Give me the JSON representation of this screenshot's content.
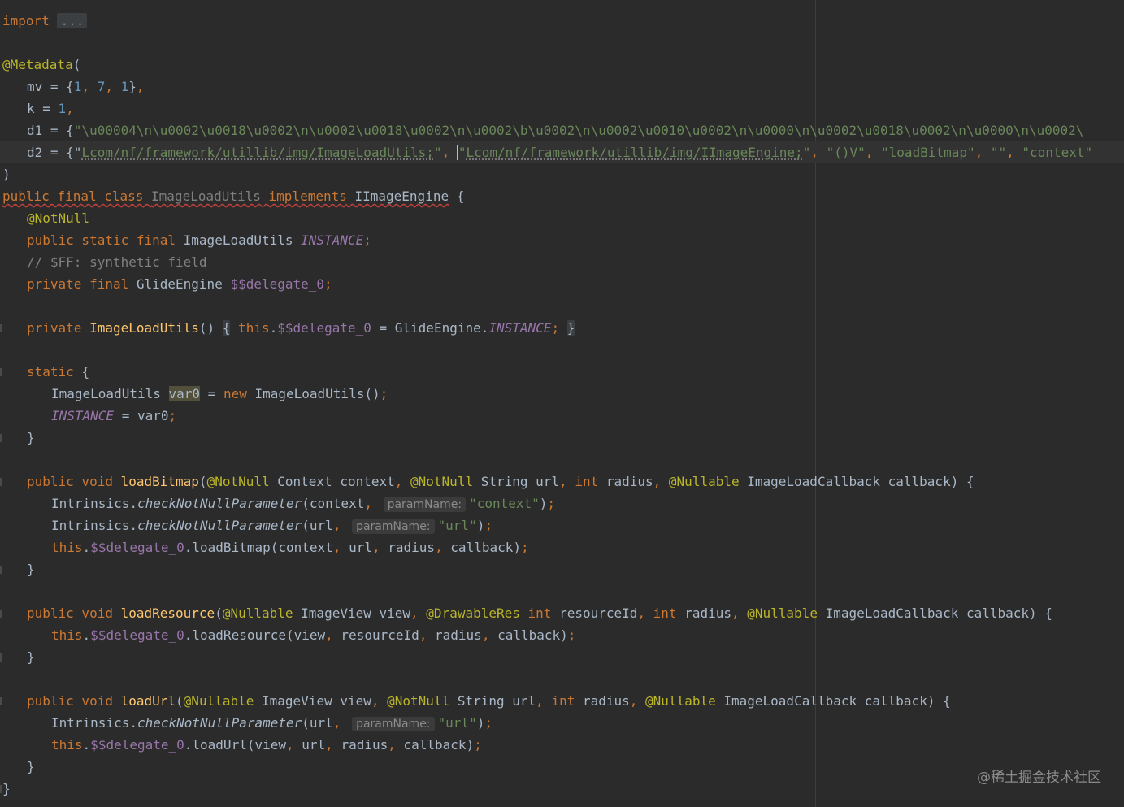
{
  "editor": {
    "current_line_index": 6,
    "lines": [
      {
        "indent": 0,
        "tokens": [
          {
            "t": "import",
            "c": "kw"
          },
          {
            "t": " "
          },
          {
            "t": "...",
            "c": "fold"
          }
        ]
      },
      {
        "indent": 0,
        "tokens": []
      },
      {
        "indent": 0,
        "tokens": [
          {
            "t": "@Metadata",
            "c": "ann"
          },
          {
            "t": "("
          }
        ]
      },
      {
        "indent": 1,
        "tokens": [
          {
            "t": "mv = {"
          },
          {
            "t": "1",
            "c": "num"
          },
          {
            "t": ", ",
            "c": "kw"
          },
          {
            "t": "7",
            "c": "num"
          },
          {
            "t": ", ",
            "c": "kw"
          },
          {
            "t": "1",
            "c": "num"
          },
          {
            "t": "}"
          },
          {
            "t": ",",
            "c": "kw"
          }
        ]
      },
      {
        "indent": 1,
        "tokens": [
          {
            "t": "k = "
          },
          {
            "t": "1",
            "c": "num"
          },
          {
            "t": ",",
            "c": "kw"
          }
        ]
      },
      {
        "indent": 1,
        "tokens": [
          {
            "t": "d1 = {"
          },
          {
            "t": "\"\\u00004\\n\\u0002\\u0018\\u0002\\n\\u0002\\u0018\\u0002\\n\\u0002\\b\\u0002\\n\\u0002\\u0010\\u0002\\n\\u0000\\n\\u0002\\u0018\\u0002\\n\\u0000\\n\\u0002\\",
            "c": "str"
          }
        ]
      },
      {
        "indent": 1,
        "tokens": [
          {
            "t": "d2 = {"
          },
          {
            "t": "\""
          },
          {
            "t": "Lcom/nf/framework/utillib/img/ImageLoadUtils;",
            "c": "str",
            "typo": true
          },
          {
            "t": "\"",
            "c": "str"
          },
          {
            "t": ", ",
            "c": "kw"
          },
          {
            "t": "",
            "caret": true
          },
          {
            "t": "\"",
            "c": "str"
          },
          {
            "t": "Lcom/nf/framework/utillib/img/IImageEngine;",
            "c": "str",
            "typo": true
          },
          {
            "t": "\"",
            "c": "str"
          },
          {
            "t": ", ",
            "c": "kw"
          },
          {
            "t": "\"()V\"",
            "c": "str"
          },
          {
            "t": ", ",
            "c": "kw"
          },
          {
            "t": "\"loadBitmap\"",
            "c": "str"
          },
          {
            "t": ", ",
            "c": "kw"
          },
          {
            "t": "\"\"",
            "c": "str"
          },
          {
            "t": ", ",
            "c": "kw"
          },
          {
            "t": "\"context\"",
            "c": "str"
          }
        ]
      },
      {
        "indent": 0,
        "tokens": [
          {
            "t": ")"
          }
        ]
      },
      {
        "indent": 0,
        "tokens": [
          {
            "t": "public final class ",
            "c": "kw",
            "warn": true
          },
          {
            "t": "ImageLoadUtils",
            "c": "unused",
            "warn": true
          },
          {
            "t": " ",
            "warn": true
          },
          {
            "t": "implements",
            "c": "kw",
            "warn": true
          },
          {
            "t": " IImageEngine",
            "warn": true
          },
          {
            "t": " {"
          }
        ]
      },
      {
        "indent": 1,
        "tokens": [
          {
            "t": "@NotNull",
            "c": "ann"
          }
        ]
      },
      {
        "indent": 1,
        "tokens": [
          {
            "t": "public static final ",
            "c": "kw"
          },
          {
            "t": "ImageLoadUtils "
          },
          {
            "t": "INSTANCE",
            "c": "static"
          },
          {
            "t": ";",
            "c": "kw"
          }
        ]
      },
      {
        "indent": 1,
        "tokens": [
          {
            "t": "// $FF: synthetic field",
            "c": "cmt"
          }
        ]
      },
      {
        "indent": 1,
        "tokens": [
          {
            "t": "private final ",
            "c": "kw"
          },
          {
            "t": "GlideEngine "
          },
          {
            "t": "$$delegate_0",
            "c": "field"
          },
          {
            "t": ";",
            "c": "kw"
          }
        ]
      },
      {
        "indent": 0,
        "tokens": []
      },
      {
        "indent": 1,
        "tokens": [
          {
            "t": "private ",
            "c": "kw"
          },
          {
            "t": "ImageLoadUtils",
            "c": "method"
          },
          {
            "t": "() "
          },
          {
            "t": "{",
            "c": "foldbrace"
          },
          {
            "t": " "
          },
          {
            "t": "this",
            "c": "kw"
          },
          {
            "t": "."
          },
          {
            "t": "$$delegate_0",
            "c": "field"
          },
          {
            "t": " = GlideEngine."
          },
          {
            "t": "INSTANCE",
            "c": "static"
          },
          {
            "t": ";",
            "c": "kw"
          },
          {
            "t": " "
          },
          {
            "t": "}",
            "c": "foldbrace"
          }
        ]
      },
      {
        "indent": 0,
        "tokens": []
      },
      {
        "indent": 1,
        "tokens": [
          {
            "t": "static ",
            "c": "kw"
          },
          {
            "t": "{"
          }
        ]
      },
      {
        "indent": 2,
        "tokens": [
          {
            "t": "ImageLoadUtils "
          },
          {
            "t": "var0",
            "hl": true
          },
          {
            "t": " = "
          },
          {
            "t": "new ",
            "c": "kw"
          },
          {
            "t": "ImageLoadUtils()"
          },
          {
            "t": ";",
            "c": "kw"
          }
        ]
      },
      {
        "indent": 2,
        "tokens": [
          {
            "t": "INSTANCE",
            "c": "static"
          },
          {
            "t": " = var0"
          },
          {
            "t": ";",
            "c": "kw"
          }
        ]
      },
      {
        "indent": 1,
        "tokens": [
          {
            "t": "}"
          }
        ]
      },
      {
        "indent": 0,
        "tokens": []
      },
      {
        "indent": 1,
        "tokens": [
          {
            "t": "public void ",
            "c": "kw"
          },
          {
            "t": "loadBitmap",
            "c": "method"
          },
          {
            "t": "("
          },
          {
            "t": "@NotNull",
            "c": "ann"
          },
          {
            "t": " Context context"
          },
          {
            "t": ", ",
            "c": "kw"
          },
          {
            "t": "@NotNull",
            "c": "ann"
          },
          {
            "t": " String url"
          },
          {
            "t": ", ",
            "c": "kw"
          },
          {
            "t": "int ",
            "c": "kw"
          },
          {
            "t": "radius"
          },
          {
            "t": ", ",
            "c": "kw"
          },
          {
            "t": "@Nullable",
            "c": "ann"
          },
          {
            "t": " ImageLoadCallback callback) {"
          }
        ]
      },
      {
        "indent": 2,
        "tokens": [
          {
            "t": "Intrinsics."
          },
          {
            "t": "checkNotNullParameter",
            "c": "ital"
          },
          {
            "t": "(context"
          },
          {
            "t": ", ",
            "c": "kw"
          },
          {
            "t": "paramName:",
            "c": "hint"
          },
          {
            "t": "\"context\"",
            "c": "str"
          },
          {
            "t": ")"
          },
          {
            "t": ";",
            "c": "kw"
          }
        ]
      },
      {
        "indent": 2,
        "tokens": [
          {
            "t": "Intrinsics."
          },
          {
            "t": "checkNotNullParameter",
            "c": "ital"
          },
          {
            "t": "(url"
          },
          {
            "t": ", ",
            "c": "kw"
          },
          {
            "t": "paramName:",
            "c": "hint"
          },
          {
            "t": "\"url\"",
            "c": "str"
          },
          {
            "t": ")"
          },
          {
            "t": ";",
            "c": "kw"
          }
        ]
      },
      {
        "indent": 2,
        "tokens": [
          {
            "t": "this",
            "c": "kw"
          },
          {
            "t": "."
          },
          {
            "t": "$$delegate_0",
            "c": "field"
          },
          {
            "t": ".loadBitmap(context"
          },
          {
            "t": ", ",
            "c": "kw"
          },
          {
            "t": "url"
          },
          {
            "t": ", ",
            "c": "kw"
          },
          {
            "t": "radius"
          },
          {
            "t": ", ",
            "c": "kw"
          },
          {
            "t": "callback)"
          },
          {
            "t": ";",
            "c": "kw"
          }
        ]
      },
      {
        "indent": 1,
        "tokens": [
          {
            "t": "}"
          }
        ]
      },
      {
        "indent": 0,
        "tokens": []
      },
      {
        "indent": 1,
        "tokens": [
          {
            "t": "public void ",
            "c": "kw"
          },
          {
            "t": "loadResource",
            "c": "method"
          },
          {
            "t": "("
          },
          {
            "t": "@Nullable",
            "c": "ann"
          },
          {
            "t": " ImageView view"
          },
          {
            "t": ", ",
            "c": "kw"
          },
          {
            "t": "@DrawableRes",
            "c": "ann"
          },
          {
            "t": " "
          },
          {
            "t": "int ",
            "c": "kw"
          },
          {
            "t": "resourceId"
          },
          {
            "t": ", ",
            "c": "kw"
          },
          {
            "t": "int ",
            "c": "kw"
          },
          {
            "t": "radius"
          },
          {
            "t": ", ",
            "c": "kw"
          },
          {
            "t": "@Nullable",
            "c": "ann"
          },
          {
            "t": " ImageLoadCallback callback) {"
          }
        ]
      },
      {
        "indent": 2,
        "tokens": [
          {
            "t": "this",
            "c": "kw"
          },
          {
            "t": "."
          },
          {
            "t": "$$delegate_0",
            "c": "field"
          },
          {
            "t": ".loadResource(view"
          },
          {
            "t": ", ",
            "c": "kw"
          },
          {
            "t": "resourceId"
          },
          {
            "t": ", ",
            "c": "kw"
          },
          {
            "t": "radius"
          },
          {
            "t": ", ",
            "c": "kw"
          },
          {
            "t": "callback)"
          },
          {
            "t": ";",
            "c": "kw"
          }
        ]
      },
      {
        "indent": 1,
        "tokens": [
          {
            "t": "}"
          }
        ]
      },
      {
        "indent": 0,
        "tokens": []
      },
      {
        "indent": 1,
        "tokens": [
          {
            "t": "public void ",
            "c": "kw"
          },
          {
            "t": "loadUrl",
            "c": "method"
          },
          {
            "t": "("
          },
          {
            "t": "@Nullable",
            "c": "ann"
          },
          {
            "t": " ImageView view"
          },
          {
            "t": ", ",
            "c": "kw"
          },
          {
            "t": "@NotNull",
            "c": "ann"
          },
          {
            "t": " String url"
          },
          {
            "t": ", ",
            "c": "kw"
          },
          {
            "t": "int ",
            "c": "kw"
          },
          {
            "t": "radius"
          },
          {
            "t": ", ",
            "c": "kw"
          },
          {
            "t": "@Nullable",
            "c": "ann"
          },
          {
            "t": " ImageLoadCallback callback) {"
          }
        ]
      },
      {
        "indent": 2,
        "tokens": [
          {
            "t": "Intrinsics."
          },
          {
            "t": "checkNotNullParameter",
            "c": "ital"
          },
          {
            "t": "(url"
          },
          {
            "t": ", ",
            "c": "kw"
          },
          {
            "t": "paramName:",
            "c": "hint"
          },
          {
            "t": "\"url\"",
            "c": "str"
          },
          {
            "t": ")"
          },
          {
            "t": ";",
            "c": "kw"
          }
        ]
      },
      {
        "indent": 2,
        "tokens": [
          {
            "t": "this",
            "c": "kw"
          },
          {
            "t": "."
          },
          {
            "t": "$$delegate_0",
            "c": "field"
          },
          {
            "t": ".loadUrl(view"
          },
          {
            "t": ", ",
            "c": "kw"
          },
          {
            "t": "url"
          },
          {
            "t": ", ",
            "c": "kw"
          },
          {
            "t": "radius"
          },
          {
            "t": ", ",
            "c": "kw"
          },
          {
            "t": "callback)"
          },
          {
            "t": ";",
            "c": "kw"
          }
        ]
      },
      {
        "indent": 1,
        "tokens": [
          {
            "t": "}"
          }
        ]
      },
      {
        "indent": 0,
        "tokens": [
          {
            "t": "}"
          }
        ]
      }
    ],
    "fold_marker_lines": [
      14,
      16,
      19,
      21,
      25,
      27,
      29,
      31,
      35
    ]
  },
  "watermark": "@稀土掘金技术社区",
  "colors": {
    "background": "#2b2b2b",
    "current_line": "#323232",
    "keyword": "#cc7832",
    "annotation": "#bbb529",
    "string": "#6a8759",
    "number": "#6897bb",
    "field": "#9876aa",
    "method": "#ffc66d",
    "comment": "#808080",
    "text": "#a9b7c6"
  }
}
